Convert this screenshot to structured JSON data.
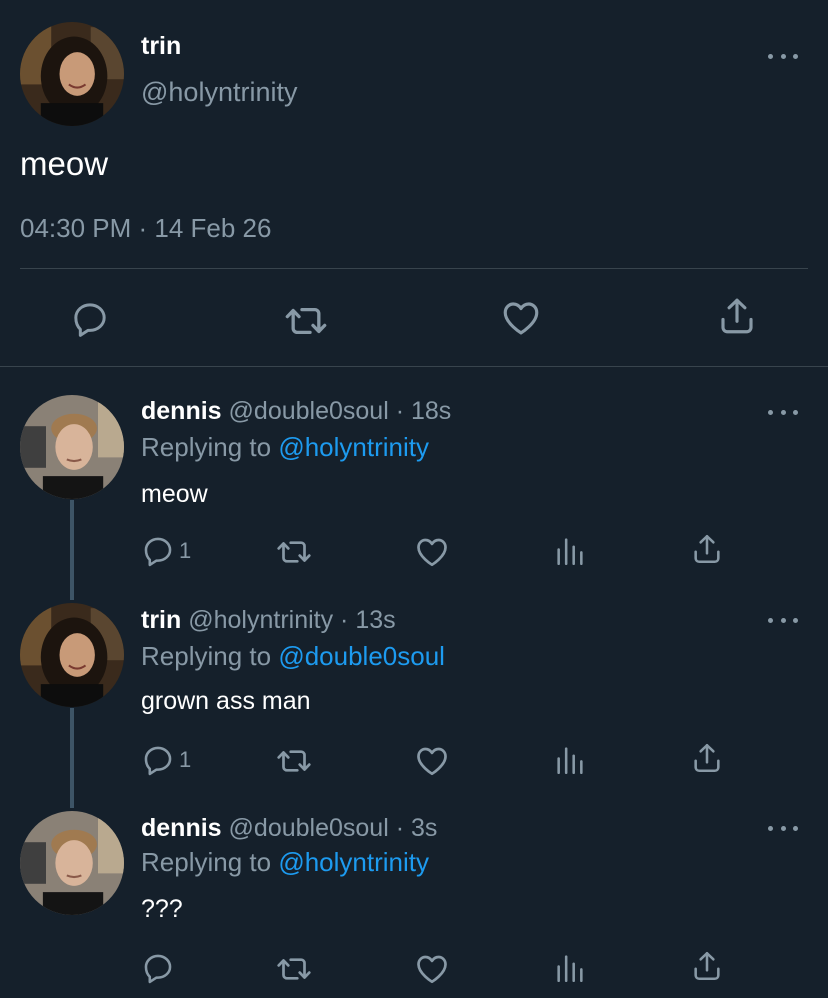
{
  "main_tweet": {
    "name": "trin",
    "handle": "@holyntrinity",
    "text": "meow",
    "timestamp": "04:30 PM · 14 Feb 26",
    "actions": [
      "reply-icon",
      "retweet-icon",
      "like-icon",
      "share-icon"
    ]
  },
  "replies": [
    {
      "name": "dennis",
      "handle": "@double0soul",
      "time": "18s",
      "replying_prefix": "Replying to ",
      "replying_to": "@holyntrinity",
      "text": "meow",
      "reply_count": "1"
    },
    {
      "name": "trin",
      "handle": "@holyntrinity",
      "time": "13s",
      "replying_prefix": "Replying to ",
      "replying_to": "@double0soul",
      "text": "grown ass man",
      "reply_count": "1"
    },
    {
      "name": "dennis",
      "handle": "@double0soul",
      "time": "3s",
      "replying_prefix": "Replying to ",
      "replying_to": "@holyntrinity",
      "text": "???",
      "reply_count": ""
    }
  ],
  "separator": " · ",
  "colors": {
    "background": "#15202b",
    "secondary_text": "#8899a6",
    "mention": "#1d9bf0",
    "divider": "#38444d"
  }
}
